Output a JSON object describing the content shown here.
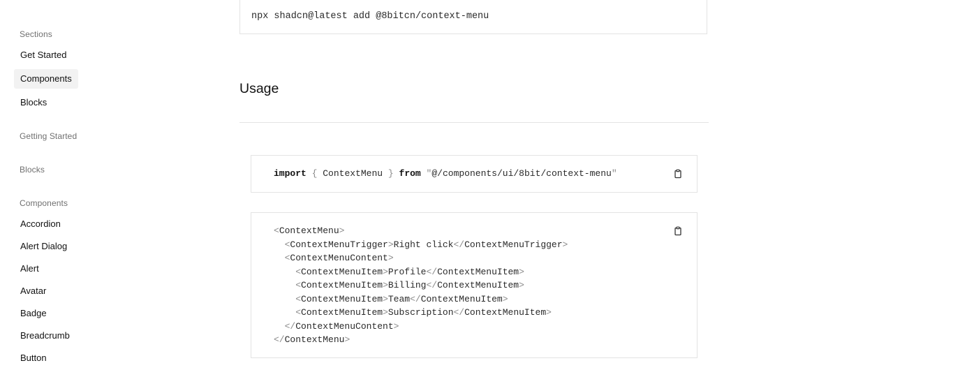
{
  "sidebar": {
    "sections_heading": "Sections",
    "top_items": [
      "Get Started",
      "Components",
      "Blocks"
    ],
    "getting_started_heading": "Getting Started",
    "blocks_heading": "Blocks",
    "components_heading": "Components",
    "component_items": [
      "Accordion",
      "Alert Dialog",
      "Alert",
      "Avatar",
      "Badge",
      "Breadcrumb",
      "Button"
    ]
  },
  "install": {
    "command": "npx shadcn@latest add @8bitcn/context-menu"
  },
  "usage": {
    "heading": "Usage"
  },
  "import_code": {
    "keyword_import": "import",
    "brace_open": "{",
    "name": "ContextMenu",
    "brace_close": "}",
    "keyword_from": "from",
    "quote_open": "\"",
    "path": "@/components/ui/8bit/context-menu",
    "quote_close": "\""
  },
  "jsx_code": {
    "lines": [
      {
        "indent": "",
        "open": "<",
        "tag": "ContextMenu",
        "close": ">",
        "text": "",
        "end_open": "",
        "end_tag": "",
        "end_close": ""
      },
      {
        "indent": "  ",
        "open": "<",
        "tag": "ContextMenuTrigger",
        "close": ">",
        "text": "Right click",
        "end_open": "</",
        "end_tag": "ContextMenuTrigger",
        "end_close": ">"
      },
      {
        "indent": "  ",
        "open": "<",
        "tag": "ContextMenuContent",
        "close": ">",
        "text": "",
        "end_open": "",
        "end_tag": "",
        "end_close": ""
      },
      {
        "indent": "    ",
        "open": "<",
        "tag": "ContextMenuItem",
        "close": ">",
        "text": "Profile",
        "end_open": "</",
        "end_tag": "ContextMenuItem",
        "end_close": ">"
      },
      {
        "indent": "    ",
        "open": "<",
        "tag": "ContextMenuItem",
        "close": ">",
        "text": "Billing",
        "end_open": "</",
        "end_tag": "ContextMenuItem",
        "end_close": ">"
      },
      {
        "indent": "    ",
        "open": "<",
        "tag": "ContextMenuItem",
        "close": ">",
        "text": "Team",
        "end_open": "</",
        "end_tag": "ContextMenuItem",
        "end_close": ">"
      },
      {
        "indent": "    ",
        "open": "<",
        "tag": "ContextMenuItem",
        "close": ">",
        "text": "Subscription",
        "end_open": "</",
        "end_tag": "ContextMenuItem",
        "end_close": ">"
      },
      {
        "indent": "  ",
        "open": "</",
        "tag": "ContextMenuContent",
        "close": ">",
        "text": "",
        "end_open": "",
        "end_tag": "",
        "end_close": ""
      },
      {
        "indent": "",
        "open": "</",
        "tag": "ContextMenu",
        "close": ">",
        "text": "",
        "end_open": "",
        "end_tag": "",
        "end_close": ""
      }
    ]
  },
  "icons": {
    "copy": "clipboard-icon"
  },
  "colors": {
    "active_item_bg": "#f2f2f2",
    "border": "#e3e3e3",
    "muted_text": "#707070",
    "punctuation": "#8a8a8a"
  }
}
